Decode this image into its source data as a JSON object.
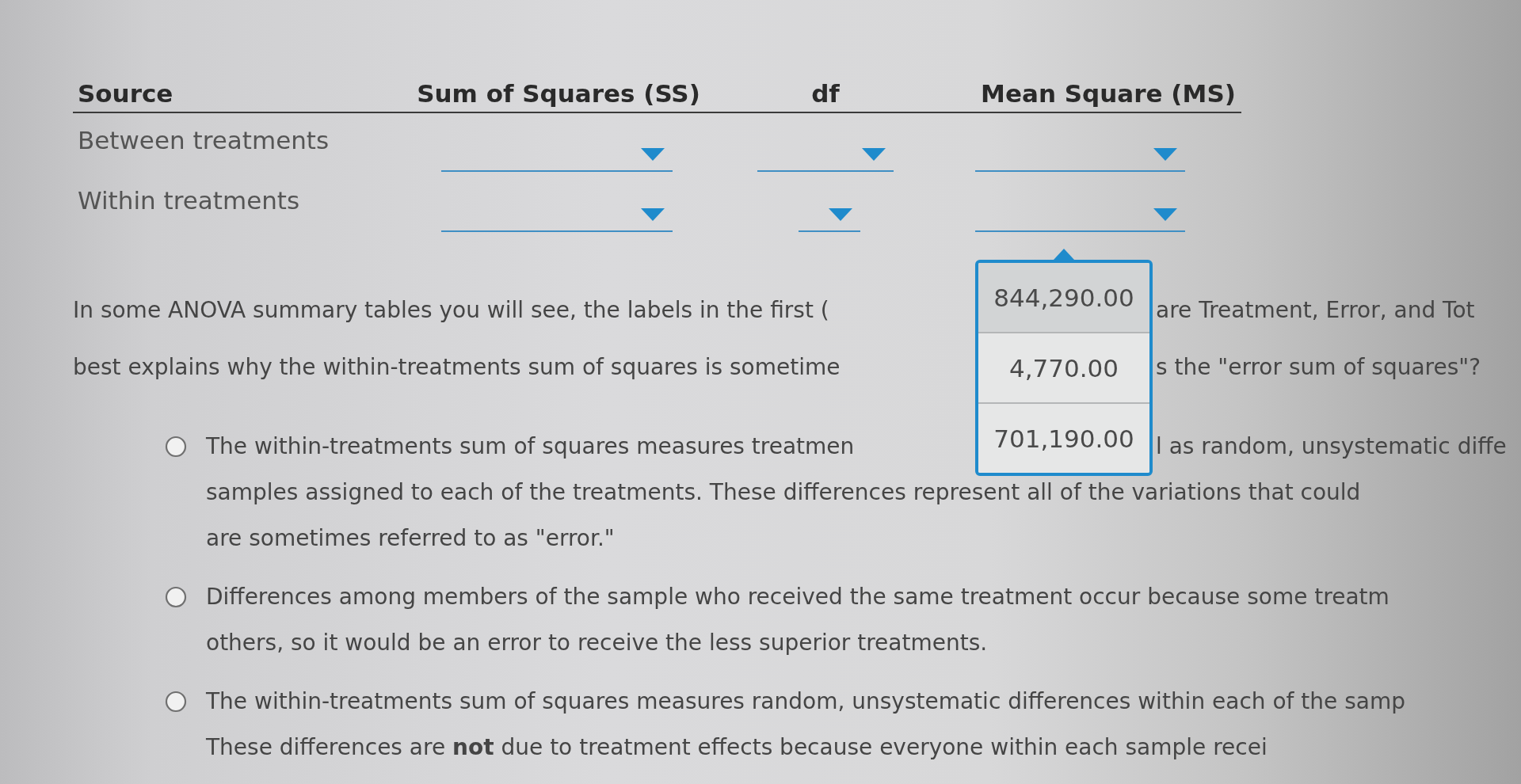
{
  "table": {
    "columns": [
      "Source",
      "Sum of Squares (SS)",
      "df",
      "Mean Square (MS)"
    ],
    "rows": [
      {
        "cells": [
          {
            "kind": "label",
            "text": "Between treatments"
          },
          {
            "kind": "dropdown",
            "compact": false
          },
          {
            "kind": "dropdown",
            "compact": false
          },
          {
            "kind": "dropdown",
            "compact": false
          }
        ]
      },
      {
        "cells": [
          {
            "kind": "label",
            "text": "Within treatments"
          },
          {
            "kind": "dropdown",
            "compact": false
          },
          {
            "kind": "dropdown",
            "compact": true
          },
          {
            "kind": "dropdown",
            "compact": false,
            "options": [
              {
                "label": "844,290.00",
                "highlighted": true
              },
              {
                "label": "4,770.00",
                "highlighted": false
              },
              {
                "label": "701,190.00",
                "highlighted": false
              }
            ]
          }
        ]
      }
    ]
  },
  "question": {
    "lines": [
      [
        "In some ANOVA summary tables you will see, the labels in the first (",
        "are Treatment, Error, and Tot"
      ],
      [
        "best explains why the within-treatments sum of squares is sometime",
        "s the \"error sum of squares\"?"
      ]
    ]
  },
  "options": [
    {
      "selected": false,
      "lines": [
        [
          "The within-treatments sum of squares measures treatmen",
          "l as random, unsystematic diffe"
        ],
        [
          "samples assigned to each of the treatments. These differences represent all of the variations that could"
        ],
        [
          "are sometimes referred to as \"error.\""
        ]
      ]
    },
    {
      "selected": false,
      "lines": [
        [
          "Differences among members of the sample who received the same treatment occur because some treatm"
        ],
        [
          "others, so it would be an error to receive the less superior treatments."
        ]
      ]
    },
    {
      "selected": false,
      "lines": [
        [
          "The within-treatments sum of squares measures random, unsystematic differences within each of the samp"
        ],
        [
          "These differences are **not** due to treatment effects because everyone within each sample recei"
        ]
      ]
    }
  ]
}
